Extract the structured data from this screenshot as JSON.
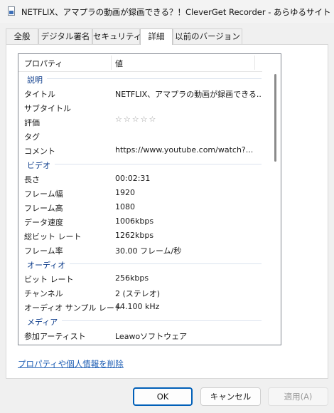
{
  "window": {
    "title": "NETFLIX、アマプラの動画が録画できる？！CleverGet Recorder - あらゆるサイトか..."
  },
  "tabs": [
    {
      "label": "全般",
      "active": false
    },
    {
      "label": "デジタル署名",
      "active": false
    },
    {
      "label": "セキュリティ",
      "active": false
    },
    {
      "label": "詳細",
      "active": true
    },
    {
      "label": "以前のバージョン",
      "active": false
    }
  ],
  "list": {
    "header": {
      "property": "プロパティ",
      "value": "値"
    },
    "groups": [
      {
        "title": "説明",
        "rows": [
          {
            "key": "タイトル",
            "value": "NETFLIX、アマプラの動画が録画できる..."
          },
          {
            "key": "サブタイトル",
            "value": ""
          },
          {
            "key": "評価",
            "value": "☆☆☆☆☆"
          },
          {
            "key": "タグ",
            "value": ""
          },
          {
            "key": "コメント",
            "value": "https://www.youtube.com/watch?..."
          }
        ]
      },
      {
        "title": "ビデオ",
        "rows": [
          {
            "key": "長さ",
            "value": "00:02:31"
          },
          {
            "key": "フレーム幅",
            "value": "1920"
          },
          {
            "key": "フレーム高",
            "value": "1080"
          },
          {
            "key": "データ速度",
            "value": "1006kbps"
          },
          {
            "key": "総ビット レート",
            "value": "1262kbps"
          },
          {
            "key": "フレーム率",
            "value": "30.00 フレーム/秒"
          }
        ]
      },
      {
        "title": "オーディオ",
        "rows": [
          {
            "key": "ビット レート",
            "value": "256kbps"
          },
          {
            "key": "チャンネル",
            "value": "2 (ステレオ)"
          },
          {
            "key": "オーディオ サンプル レート",
            "value": "44.100 kHz"
          }
        ]
      },
      {
        "title": "メディア",
        "rows": [
          {
            "key": "参加アーティスト",
            "value": "Leawoソフトウェア"
          }
        ]
      }
    ]
  },
  "remove_link": "プロパティや個人情報を削除",
  "buttons": {
    "ok": "OK",
    "cancel": "キャンセル",
    "apply": "適用(A)"
  }
}
